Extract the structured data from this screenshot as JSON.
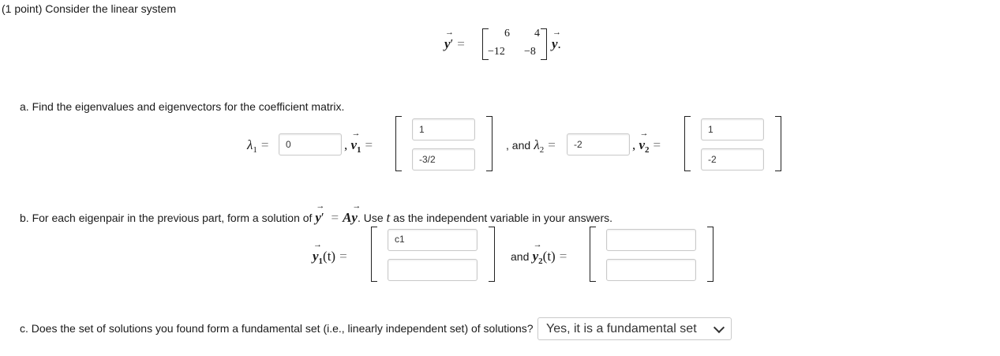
{
  "intro": "(1 point) Consider the linear system",
  "system": {
    "lhs": "y",
    "prime": "′",
    "eq": "=",
    "matrix": [
      [
        "6",
        "4"
      ],
      [
        "−12",
        "−8"
      ]
    ],
    "rhs": "y",
    "period": "."
  },
  "part_a": {
    "question": "a. Find the eigenvalues and eigenvectors for the coefficient matrix.",
    "lambda_sym": "λ",
    "sub1": "1",
    "sub2": "2",
    "eq": "=",
    "v_sym": "v",
    "comma": ",",
    "and_text": ", and",
    "lambda1_value": "0",
    "v1": [
      "1",
      "-3/2"
    ],
    "lambda2_value": "-2",
    "v2": [
      "1",
      "-2"
    ]
  },
  "part_b": {
    "question_pre": "b. For each eigenpair in the previous part, form a solution of",
    "question_mid": "= Ay. Use",
    "A_sym": "A",
    "y_sym": "y",
    "prime": "′",
    "t_sym": "t",
    "question_post": "as the independent variable in your answers.",
    "y1_label": "y",
    "arg": "(t)",
    "and_text": "and",
    "y1": [
      "c1",
      ""
    ],
    "y2": [
      "",
      ""
    ]
  },
  "part_c": {
    "question": "c. Does the set of solutions you found form a fundamental set (i.e., linearly independent set) of solutions?",
    "selected": "Yes, it is a fundamental set"
  }
}
